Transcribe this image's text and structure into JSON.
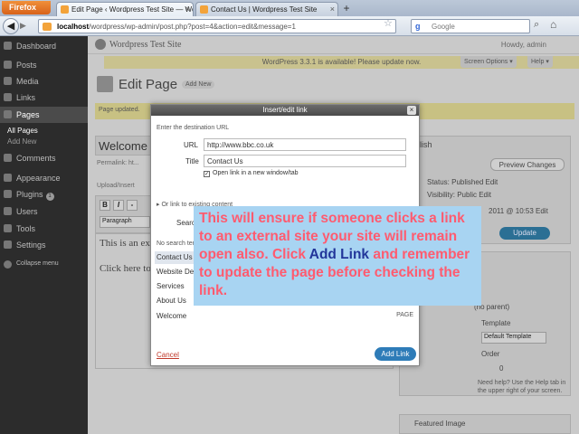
{
  "browser": {
    "menu_label": "Firefox",
    "tabs": [
      {
        "label": "Edit Page ‹ Wordpress Test Site — Wo..."
      },
      {
        "label": "Contact Us | Wordpress Test Site"
      }
    ],
    "url_host": "localhost",
    "url_rest": "/wordpress/wp-admin/post.php?post=4&action=edit&message=1",
    "search_placeholder": "Google"
  },
  "sidebar": {
    "items": [
      {
        "label": "Dashboard"
      },
      {
        "label": "Posts"
      },
      {
        "label": "Media"
      },
      {
        "label": "Links"
      },
      {
        "label": "Pages"
      },
      {
        "label": "Comments"
      },
      {
        "label": "Appearance"
      },
      {
        "label": "Plugins"
      },
      {
        "label": "Users"
      },
      {
        "label": "Tools"
      },
      {
        "label": "Settings"
      },
      {
        "label": "Collapse menu"
      }
    ],
    "sub_items": [
      {
        "label": "All Pages"
      },
      {
        "label": "Add New"
      }
    ],
    "plugins_badge": "1"
  },
  "header": {
    "site_title": "Wordpress Test Site",
    "howdy": "Howdy, admin",
    "notice": "WordPress 3.3.1 is available! Please update now.",
    "screen_options": "Screen Options ▾",
    "help": "Help ▾"
  },
  "page": {
    "heading": "Edit Page",
    "add_new": "Add New",
    "updated_msg": "Page updated.",
    "title_value": "Welcome",
    "permalink": "Permalink: ht...",
    "upload_insert": "Upload/Insert",
    "paragraph": "Paragraph",
    "editor_line1": "This is an ex...",
    "editor_line2": "Click here to..."
  },
  "publish": {
    "heading": "Publish",
    "preview": "Preview Changes",
    "status": "Status: Published Edit",
    "visibility": "Visibility: Public Edit",
    "date": "2011 @ 10:53 Edit",
    "update": "Update"
  },
  "attributes": {
    "parent": "(no parent)",
    "template": "Template",
    "template_value": "Default Template",
    "order": "Order",
    "order_value": "0",
    "help": "Need help? Use the Help tab in the upper right of your screen."
  },
  "featured_image": "Featured Image",
  "modal": {
    "title": "Insert/edit link",
    "close": "×",
    "dest_heading": "Enter the destination URL",
    "url_label": "URL",
    "url_value": "http://www.bbc.co.uk",
    "title_label": "Title",
    "title_value": "Contact Us",
    "new_window": "Open link in a new window/tab",
    "existing": "▸ Or link to existing content",
    "search_label": "Search",
    "no_search": "No search term specified. Showing recent items.",
    "rows": [
      {
        "label": "Contact Us",
        "kind": ""
      },
      {
        "label": "Website De...",
        "kind": ""
      },
      {
        "label": "Services",
        "kind": ""
      },
      {
        "label": "About Us",
        "kind": ""
      },
      {
        "label": "Welcome",
        "kind": "PAGE"
      }
    ],
    "cancel": "Cancel",
    "add_link": "Add Link"
  },
  "tip": {
    "text_before": "This will ensure if someone clicks a link to an external site your site will remain open also. Click ",
    "highlight": "Add Link",
    "text_after": " and remember to update the page before checking the link."
  },
  "colors": {
    "tip_bg": "#a8d4f2",
    "tip_text": "#ff5b6f",
    "tip_highlight": "#22369a",
    "primary_button": "#2e7cb8"
  }
}
